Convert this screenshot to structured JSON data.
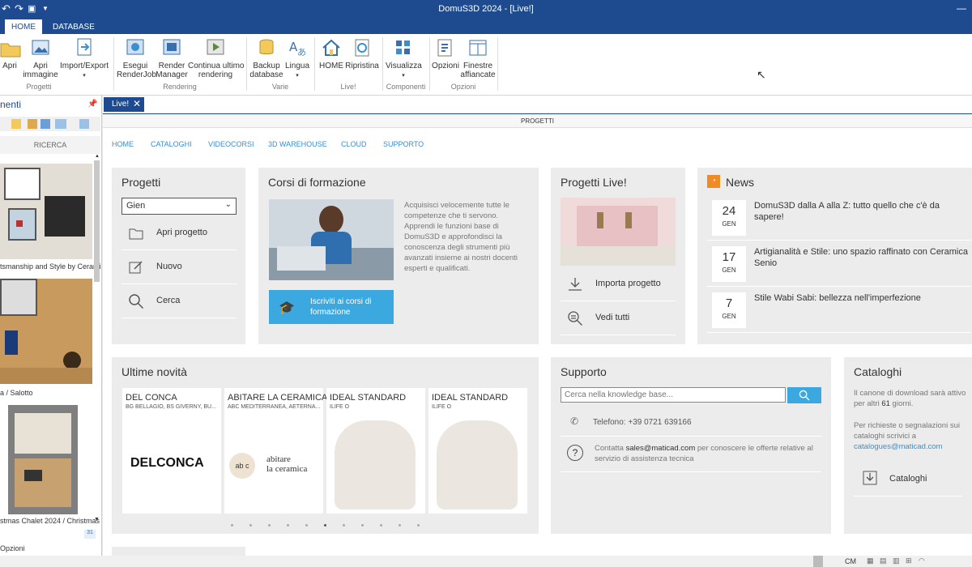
{
  "window": {
    "title": "DomuS3D 2024 - [Live!]"
  },
  "ribbon_tabs": [
    "HOME",
    "DATABASE"
  ],
  "ribbon": {
    "groups": [
      {
        "label": "Progetti",
        "buttons": [
          "Apri",
          "Apri\nimmagine",
          "Import/Export"
        ]
      },
      {
        "label": "Rendering",
        "buttons": [
          "Esegui\nRenderJob",
          "Render\nManager",
          "Continua ultimo\nrendering"
        ]
      },
      {
        "label": "Varie",
        "buttons": [
          "Backup\ndatabase",
          "Lingua"
        ]
      },
      {
        "label": "Live!",
        "buttons": [
          "HOME",
          "Ripristina"
        ]
      },
      {
        "label": "Componenti",
        "buttons": [
          "Visualizza"
        ]
      },
      {
        "label": "Opzioni",
        "buttons": [
          "Opzioni",
          "Finestre\naffiancate"
        ]
      }
    ]
  },
  "left_panel": {
    "title": "nenti",
    "search_label": "RICERCA",
    "thumbs": [
      "tsmanship and Style by Cerami",
      "a / Salotto",
      "stmas Chalet 2024 / Christmas"
    ],
    "badge": "31",
    "footer": "Opzioni"
  },
  "doc_tab": "Live!",
  "section_header": "PROGETTI",
  "nav": [
    "HOME",
    "CATALOGHI",
    "VIDEOCORSI",
    "3D WAREHOUSE",
    "CLOUD",
    "SUPPORTO"
  ],
  "progetti": {
    "title": "Progetti",
    "select_value": "Gien",
    "rows": [
      "Apri progetto",
      "Nuovo",
      "Cerca"
    ]
  },
  "corsi": {
    "title": "Corsi di formazione",
    "text": "Acquisisci velocemente tutte le competenze che ti servono. Apprendi le funzioni base di DomuS3D e approfondisci la conoscenza degli strumenti più avanzati insieme ai nostri docenti esperti e qualificati.",
    "button": "Iscriviti ai corsi di formazione"
  },
  "live": {
    "title": "Progetti Live!",
    "rows": [
      "Importa progetto",
      "Vedi tutti"
    ]
  },
  "news": {
    "title": "News",
    "items": [
      {
        "day": "24",
        "month": "GEN",
        "text": "DomuS3D dalla A alla Z: tutto quello che c'è da sapere!"
      },
      {
        "day": "17",
        "month": "GEN",
        "text": "Artigianalità e Stile: uno spazio raffinato con Ceramica Senio"
      },
      {
        "day": "7",
        "month": "GEN",
        "text": "Stile Wabi Sabi: bellezza nell'imperfezione"
      }
    ]
  },
  "novita": {
    "title": "Ultime novità",
    "products": [
      {
        "name": "DEL CONCA",
        "sub": "BG BELLAGIO, BS GIVERNY, BU...",
        "logo": "DELCONCA"
      },
      {
        "name": "ABITARE LA CERAMICA",
        "sub": "ABC MEDITERRANEA, AETERNA...",
        "logo": "abitare\nla ceramica"
      },
      {
        "name": "IDEAL STANDARD",
        "sub": "ILIFE O",
        "logo": ""
      },
      {
        "name": "IDEAL STANDARD",
        "sub": "ILIFE O",
        "logo": ""
      }
    ]
  },
  "supporto": {
    "title": "Supporto",
    "search_placeholder": "Cerca nella knowledge base...",
    "phone": "Telefono: +39 0721 639166",
    "contact_pre": "Contatta ",
    "contact_email": "sales@maticad.com",
    "contact_post": " per conoscere le offerte relative al servizio di assistenza tecnica"
  },
  "cataloghi": {
    "title": "Cataloghi",
    "text1_pre": "Il canone di download sarà attivo per altri ",
    "days": "61",
    "text1_post": " giorni.",
    "text2": "Per richieste o segnalazioni sui cataloghi scrivici a",
    "email": "catalogues@maticad.com",
    "button": "Cataloghi"
  },
  "status": {
    "unit": "CM"
  },
  "colors": {
    "brand": "#1e4b8f",
    "accent": "#3a8fd0",
    "button": "#3ba9e0"
  }
}
